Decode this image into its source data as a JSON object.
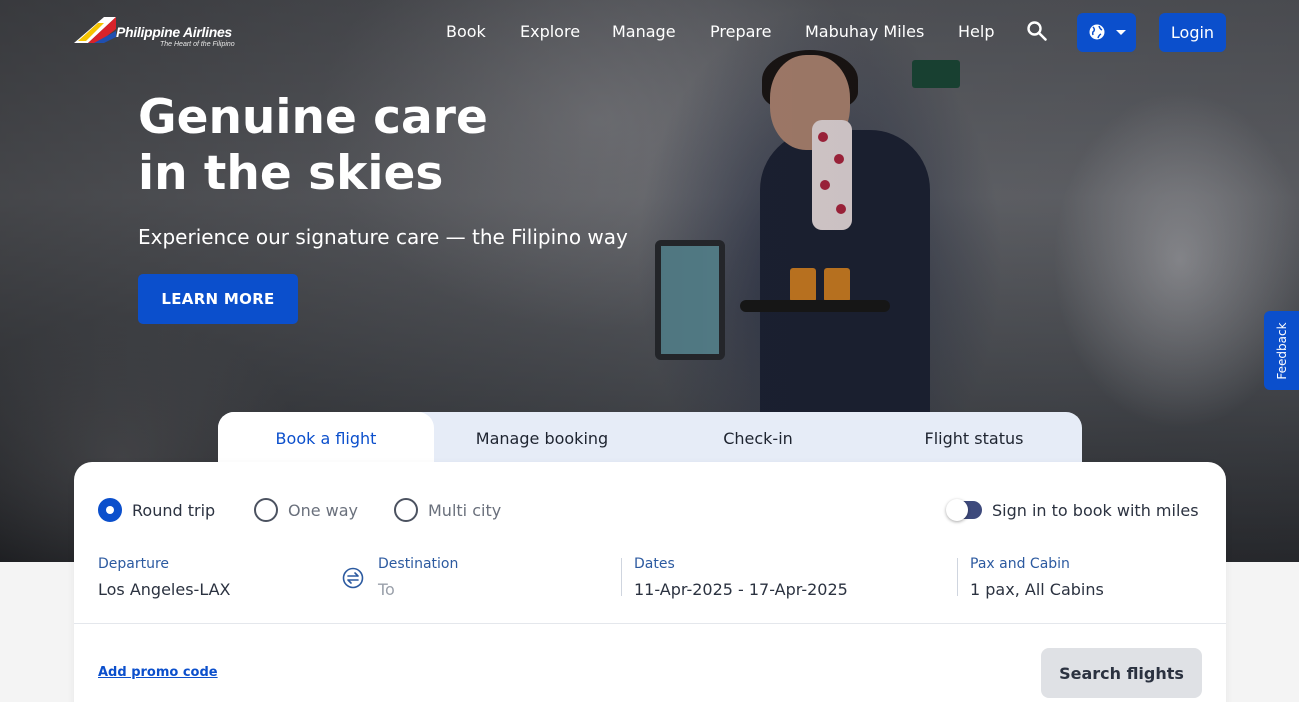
{
  "brand": {
    "name": "Philippine Airlines",
    "tagline": "The Heart of the Filipino"
  },
  "nav": {
    "items": [
      "Book",
      "Explore",
      "Manage",
      "Prepare",
      "Mabuhay Miles",
      "Help"
    ],
    "login_label": "Login"
  },
  "hero": {
    "title_line1": "Genuine care",
    "title_line2": "in the skies",
    "subtitle": "Experience our signature care — the Filipino way",
    "cta_label": "LEARN MORE"
  },
  "feedback_label": "Feedback",
  "booking": {
    "tabs": [
      {
        "label": "Book a flight",
        "active": true
      },
      {
        "label": "Manage booking",
        "active": false
      },
      {
        "label": "Check-in",
        "active": false
      },
      {
        "label": "Flight status",
        "active": false
      }
    ],
    "trip_types": [
      {
        "label": "Round trip",
        "checked": true
      },
      {
        "label": "One way",
        "checked": false
      },
      {
        "label": "Multi city",
        "checked": false
      }
    ],
    "miles_toggle_label": "Sign in to book with miles",
    "fields": {
      "departure": {
        "label": "Departure",
        "value": "Los Angeles-LAX"
      },
      "destination": {
        "label": "Destination",
        "placeholder": "To"
      },
      "dates": {
        "label": "Dates",
        "value": "11-Apr-2025 - 17-Apr-2025"
      },
      "pax": {
        "label": "Pax and Cabin",
        "value": "1 pax, All Cabins"
      }
    },
    "promo_label": "Add promo code",
    "search_label": "Search flights"
  },
  "colors": {
    "brand_blue": "#0b4fcc",
    "field_label": "#2c5aa0",
    "search_button_bg": "#dfe1e5"
  }
}
